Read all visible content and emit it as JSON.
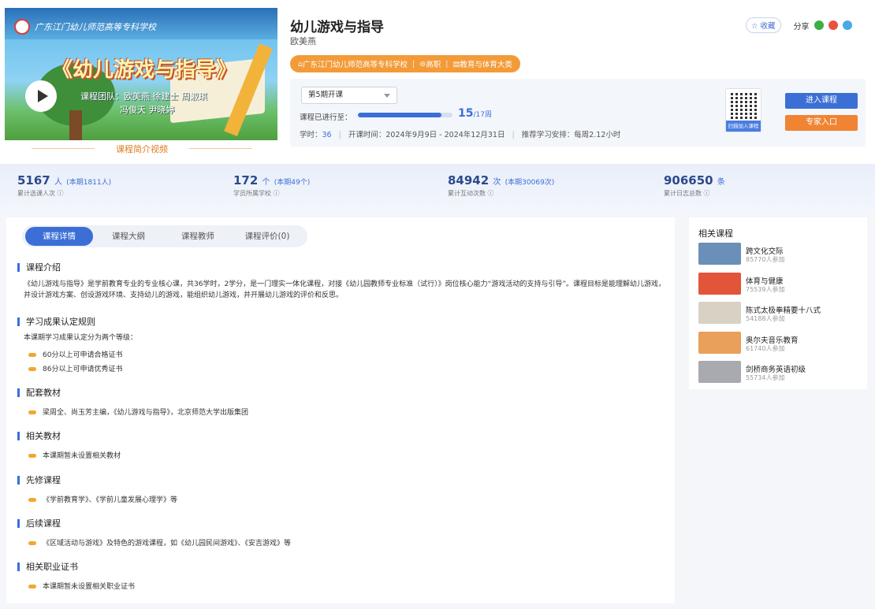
{
  "video": {
    "school_name": "广东江门幼儿师范高等专科学校",
    "title": "《幼儿游戏与指导》",
    "team_line1": "课程团队：欧美燕 徐建士 周淑琪",
    "team_line2": "冯俊天 尹晓婷",
    "caption": "课程简介视频"
  },
  "course": {
    "title": "幼儿游戏与指导",
    "teacher": "欧美燕",
    "tags": [
      "广东江门幼儿师范高等专科学校",
      "高职",
      "教育与体育大类"
    ],
    "favorite_label": "收藏",
    "share_label": "分享"
  },
  "info": {
    "term": "第5期开课",
    "progress_label": "课程已进行至：",
    "progress_current": "15",
    "progress_total": "/17周",
    "progress_fraction": 0.88,
    "hours_label": "学时：",
    "hours_value": "36",
    "dates": "开课时间：2024年9月9日 - 2024年12月31日",
    "weekly": "推荐学习安排：每周2.12小时",
    "qr_caption": "扫描加入课程",
    "enter_button": "进入课程",
    "expert_button": "专家入口"
  },
  "stats": [
    {
      "num": "5167",
      "unit": "人",
      "sub": "(本期1811人)",
      "label": "累计选课人次 ⓘ"
    },
    {
      "num": "172",
      "unit": "个",
      "sub": "(本期49个)",
      "label": "学员所属学校 ⓘ"
    },
    {
      "num": "84942",
      "unit": "次",
      "sub": "(本期30069次)",
      "label": "累计互动次数 ⓘ"
    },
    {
      "num": "906650",
      "unit": "条",
      "sub": "",
      "label": "累计日志总数 ⓘ"
    }
  ],
  "tabs": [
    "课程详情",
    "课程大纲",
    "课程教师",
    "课程评价(0)"
  ],
  "sections": {
    "intro_title": "课程介绍",
    "intro_text": "《幼儿游戏与指导》是学前教育专业的专业核心课，共36学时，2学分，是一门理实一体化课程，对接《幼儿园教师专业标准（试行）》岗位核心能力“游戏活动的支持与引导”。课程目标是能理解幼儿游戏，并设计游戏方案、创设游戏环境、支持幼儿的游戏，能组织幼儿游戏，并开展幼儿游戏的评价和反思。",
    "rules_title": "学习成果认定规则",
    "rules_intro": "本课期学习成果认定分为两个等级：",
    "rules_items": [
      "60分以上可申请合格证书",
      "86分以上可申请优秀证书"
    ],
    "textbook_title": "配套教材",
    "textbook_item": "梁周全、尚玉芳主编，《幼儿游戏与指导》，北京师范大学出版集团",
    "related_books_title": "相关教材",
    "related_books_item": "本课期暂未设置相关教材",
    "prereq_title": "先修课程",
    "prereq_item": "《学前教育学》、《学前儿童发展心理学》等",
    "follow_title": "后续课程",
    "follow_item": "《区域活动与游戏》及特色的游戏课程，如《幼儿园民间游戏》、《安吉游戏》等",
    "cert_title": "相关职业证书",
    "cert_item": "本课期暂未设置相关职业证书"
  },
  "related": {
    "title": "相关课程",
    "items": [
      {
        "name": "跨文化交际",
        "count": "85770人参加",
        "color": "#6a8fb8"
      },
      {
        "name": "体育与健康",
        "count": "75539人参加",
        "color": "#e2553a"
      },
      {
        "name": "陈式太极拳精要十八式",
        "count": "54188人参加",
        "color": "#d8d2c4"
      },
      {
        "name": "奥尔夫音乐教育",
        "count": "61740人参加",
        "color": "#e8a05a"
      },
      {
        "name": "剑桥商务英语初级",
        "count": "55734人参加",
        "color": "#a9a9b0"
      }
    ]
  },
  "colors": {
    "accent": "#3b6fd6",
    "orange": "#f08433",
    "tag": "#f29b38"
  }
}
